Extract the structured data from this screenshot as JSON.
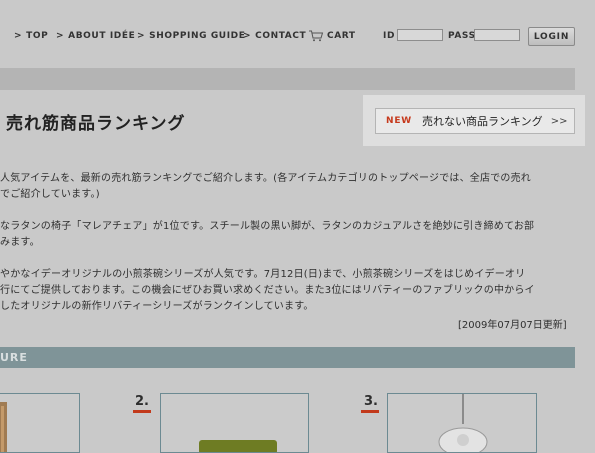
{
  "nav": {
    "top": "TOP",
    "about": "ABOUT IDÉE",
    "shopping_guide": "SHOPPING GUIDE",
    "contact": "CONTACT",
    "cart": "CART",
    "chevron": ">"
  },
  "login": {
    "id_label": "ID",
    "pass_label": "PASS",
    "button": "LOGIN"
  },
  "page_title": "売れ筋商品ランキング",
  "unpopular_link": {
    "badge": "NEW",
    "label": "売れない商品ランキング",
    "arrow": ">>"
  },
  "intro": {
    "line1": "人気アイテムを、最新の売れ筋ランキングでご紹介します。(各アイテムカテゴリのトップページでは、全店での売れ",
    "line2": "でご紹介しています。)"
  },
  "para2": {
    "line1": "なラタンの椅子「マレアチェア」が1位です。スチール製の黒い脚が、ラタンのカジュアルさを絶妙に引き締めてお部",
    "line2": "みます。"
  },
  "para3": {
    "line1": "やかなイデーオリジナルの小煎茶碗シリーズが人気です。7月12日(日)まで、小煎茶碗シリーズをはじめイデーオリ",
    "line2": "行にてご提供しております。この機会にぜひお買い求めください。また3位にはリバティーのファブリックの中からイ",
    "line3": "したオリジナルの新作リバティーシリーズがランクインしています。"
  },
  "updated": "[2009年07月07日更新]",
  "section": {
    "label": "URE"
  },
  "ranks": [
    "2.",
    "3."
  ],
  "colors": {
    "background": "#c9c9c9",
    "accent_red": "#c63a1d",
    "section_bar": "#7f9498"
  }
}
